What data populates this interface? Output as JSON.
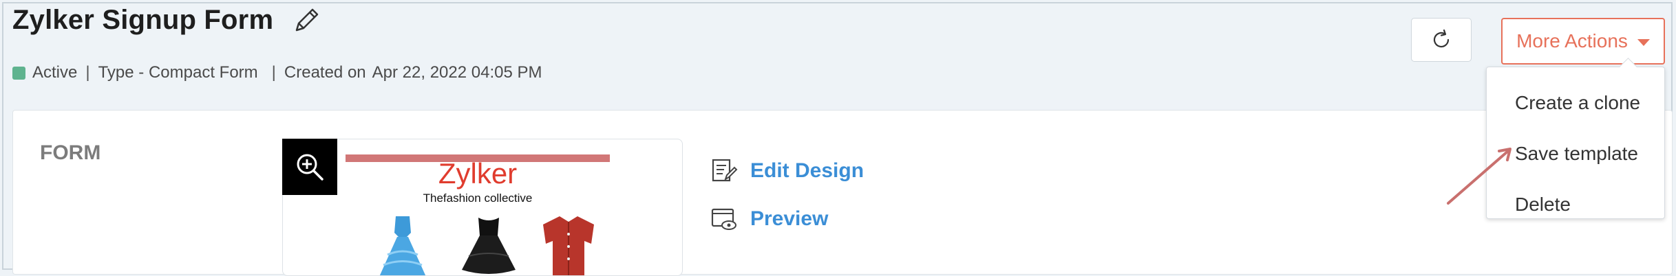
{
  "header": {
    "title": "Zylker Signup Form",
    "status": "Active",
    "type": "Type - Compact Form",
    "created_label": "Created on",
    "created_date": "Apr 22, 2022 04:05 PM",
    "separator": "|"
  },
  "toolbar": {
    "more_actions_label": "More Actions"
  },
  "dropdown": {
    "items": [
      {
        "label": "Create a clone"
      },
      {
        "label": "Save template"
      },
      {
        "label": "Delete"
      }
    ]
  },
  "form_section": {
    "heading": "FORM",
    "thumbnail": {
      "brand": "Zylker",
      "tagline": "Thefashion collective"
    },
    "actions": {
      "edit_design": "Edit Design",
      "preview": "Preview"
    }
  },
  "colors": {
    "accent": "#e7715a",
    "link": "#3b8ed6",
    "status_active": "#5fb38f",
    "brand_red": "#e03c2e"
  },
  "icons": [
    "pencil-icon",
    "refresh-icon",
    "caret-down-icon",
    "zoom-in-icon",
    "edit-design-icon",
    "preview-icon"
  ]
}
